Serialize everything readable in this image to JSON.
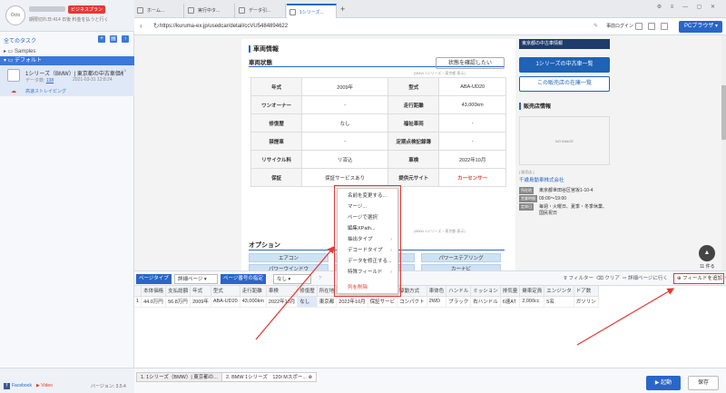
{
  "account": {
    "avatar_text": "Octo",
    "plan_badge": "ビジネスプラン",
    "expiry_text": "期限切れ日:414 日後 料金を払うと行く"
  },
  "sidebar": {
    "all_tasks": "全てのタスク",
    "folder_samples": "Samples",
    "folder_default": "デフォルト",
    "task": {
      "name": "1シリーズ（BMW）| 東京都の中古車価格...",
      "count_label": "データ数:",
      "count": "138",
      "date": "2021-03-31 12:8:24",
      "cloud_label": "高速ストレイピング"
    },
    "footer": {
      "facebook": "Facebook",
      "video": "Video",
      "version": "バージョン: 3.5.4"
    }
  },
  "tabs": [
    {
      "label": "ホーム..."
    },
    {
      "label": "実行中タ..."
    },
    {
      "label": "データ引..."
    },
    {
      "label": "1シリーズ..."
    }
  ],
  "browser": {
    "url": "https://kuruma-ex.jp/usedcar/detail/ccVU5484894622",
    "login": "事前ログイン",
    "mode_button": "PCブラウザ"
  },
  "page": {
    "section_title": "車両情報",
    "status_title": "車両状態",
    "check_button": "状態を確認したい",
    "note": "(BMW 1シリーズ・東京都 表示)",
    "spec_rows": [
      [
        "年式",
        "2009年",
        "型式",
        "ABA-UD20"
      ],
      [
        "ワンオーナー",
        "-",
        "走行距離",
        "43,000km"
      ],
      [
        "修復歴",
        "なし",
        "福祉車両",
        "-"
      ],
      [
        "禁煙車",
        "-",
        "定期点検記録簿",
        "-"
      ],
      [
        "リサイクル料",
        "リ済込",
        "車検",
        "2022年10月"
      ],
      [
        "保証",
        "保証サービスあり",
        "提供元サイト",
        "カーセンサー"
      ]
    ],
    "options_title": "オプション",
    "options": [
      {
        "label": "エアコン",
        "on": true
      },
      {
        "label": "",
        "on": true
      },
      {
        "label": "パワーステアリング",
        "on": true
      },
      {
        "label": "パワーウインドウ",
        "on": true
      },
      {
        "label": "",
        "on": true
      },
      {
        "label": "カーナビ",
        "on": true
      },
      {
        "label": "テレビ",
        "on": false
      },
      {
        "label": "",
        "on": false
      },
      {
        "label": "後席プレイヤー機能付",
        "on": false
      },
      {
        "label": "後席モニター",
        "on": false
      },
      {
        "label": "",
        "on": false
      },
      {
        "label": "運転席エアバッグ",
        "on": true
      },
      {
        "label": "助手席エアバッグ",
        "on": true
      },
      {
        "label": "",
        "on": false
      },
      {
        "label": "エアバッグ(その他)",
        "on": false
      }
    ],
    "shop": {
      "header": "東京都の中古車情報",
      "list_button": "1シリーズの中古車一覧",
      "stock_button": "この販売店の在庫一覧",
      "dealer_title": "販売店情報",
      "no_image": "NO IMAGE",
      "tag": "[ 販売店 ]",
      "name": "千歳島動車株式会社",
      "info": [
        {
          "label": "所在地",
          "value": "東京都世田谷区宮坂1-10-4"
        },
        {
          "label": "営業時間",
          "value": "09:00〜19:00"
        },
        {
          "label": "定休日",
          "value": "毎週・火曜日、夏季・冬季休業、国民祝日"
        }
      ]
    }
  },
  "context_menu": {
    "items": [
      {
        "label": "名前を変更する...",
        "submenu": false
      },
      {
        "label": "マージ...",
        "submenu": false
      },
      {
        "label": "ページで選択",
        "submenu": false
      },
      {
        "label": "編集XPath...",
        "submenu": false
      },
      {
        "label": "抽出タイプ",
        "submenu": true
      },
      {
        "label": "デコードタイプ",
        "submenu": true
      },
      {
        "label": "データを修正する...",
        "submenu": false
      },
      {
        "label": "特殊フィールド",
        "submenu": true
      }
    ],
    "delete": "列を削除"
  },
  "toolbar": {
    "page_type": "ページタイプ",
    "page_type_value": "詳細ページ",
    "position": "ページ番号の指定",
    "position_value": "なし",
    "filter": "フィルター",
    "clear": "クリア",
    "detail": "詳細ページに行く",
    "add_field": "フィールドを追加",
    "up_count": "11 件る"
  },
  "table": {
    "headers": [
      "",
      "本体価格",
      "支払総額",
      "年式",
      "型式",
      "走行距離",
      "車検",
      "修復歴",
      "所在地",
      "保証",
      "ボディタイ",
      "駆動方式",
      "車体色",
      "ハンドル",
      "ミッション",
      "排気量",
      "乗車定員",
      "エンジンタ",
      "ドア数"
    ],
    "rows": [
      [
        "1",
        "44.0万円",
        "56.8万円",
        "2009年",
        "ABA-UD20",
        "43,000km",
        "2022年10月",
        "なし",
        "東京都",
        "2022年10月",
        "保証サービ",
        "コンパクト",
        "2WD",
        "ブラック",
        "右ハンドル",
        "6速AT",
        "2,000cc",
        "5名",
        "ガソリン"
      ]
    ]
  },
  "bottom_tabs": [
    {
      "label": "1. 1シリーズ（BMW）| 東京都の..."
    },
    {
      "label": "2. BMW 1シリーズ　120i Mスポー..."
    }
  ],
  "footer_buttons": {
    "start": "起動",
    "save": "保存"
  }
}
